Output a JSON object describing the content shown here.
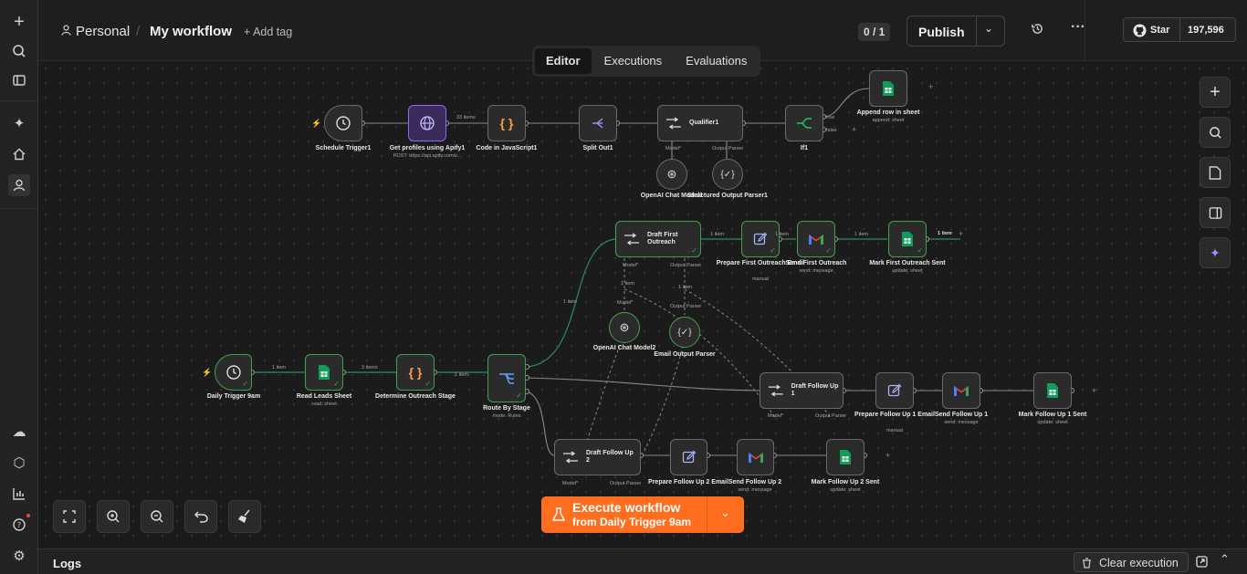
{
  "header": {
    "project": "Personal",
    "workflow_name": "My workflow",
    "add_tag": "+ Add tag",
    "counter": "0 / 1",
    "publish": "Publish",
    "github_star": "Star",
    "star_count": "197,596"
  },
  "tabs": [
    {
      "label": "Editor"
    },
    {
      "label": "Executions"
    },
    {
      "label": "Evaluations"
    }
  ],
  "nodes": {
    "schedule_trigger": {
      "label": "Schedule Trigger1"
    },
    "get_profiles": {
      "label": "Get profiles using Apify1",
      "sub": "POST: https://api.apify.com/v..."
    },
    "code_js": {
      "label": "Code in JavaScript1"
    },
    "split_out": {
      "label": "Split Out1"
    },
    "qualifier": {
      "label": "Qualifier1",
      "model": "Model*",
      "parser": "Output Parser"
    },
    "if1": {
      "label": "If1",
      "true": "true",
      "false": "false"
    },
    "append_row": {
      "label": "Append row in sheet",
      "sub": "append: sheet"
    },
    "openai1": {
      "label": "OpenAI Chat Model1"
    },
    "structured_parser": {
      "label": "Structured Output Parser1"
    },
    "daily_trigger": {
      "label": "Daily Trigger 9am"
    },
    "read_leads": {
      "label": "Read Leads Sheet",
      "sub": "read: sheet"
    },
    "determine_stage": {
      "label": "Determine Outreach Stage"
    },
    "route_stage": {
      "label": "Route By Stage",
      "sub": "mode: Rules"
    },
    "draft_first": {
      "label": "Draft First Outreach",
      "model": "Model*",
      "parser": "Output Parser"
    },
    "prepare_first": {
      "label": "Prepare First Outreach Email",
      "sub": "manual"
    },
    "send_first": {
      "label": "Send First Outreach",
      "sub": "send: message"
    },
    "mark_first": {
      "label": "Mark First Outreach Sent",
      "sub": "update: sheet"
    },
    "openai2": {
      "label": "OpenAI Chat Model2"
    },
    "email_parser": {
      "label": "Email Output Parser"
    },
    "draft_fu1": {
      "label": "Draft Follow Up 1",
      "model": "Model*",
      "parser": "Output Parser"
    },
    "prepare_fu1": {
      "label": "Prepare Follow Up 1 Email",
      "sub": "manual"
    },
    "send_fu1": {
      "label": "Send Follow Up 1",
      "sub": "send: message"
    },
    "mark_fu1": {
      "label": "Mark Follow Up 1 Sent",
      "sub": "update: sheet"
    },
    "draft_fu2": {
      "label": "Draft Follow Up 2",
      "model": "Model*",
      "parser": "Output Parser"
    },
    "prepare_fu2": {
      "label": "Prepare Follow Up 2 Email"
    },
    "send_fu2": {
      "label": "Send Follow Up 2",
      "sub": "send: message"
    },
    "mark_fu2": {
      "label": "Mark Follow Up 2 Sent",
      "sub": "update: sheet"
    }
  },
  "connections": {
    "items_33": "33 items",
    "one_item": "1 item",
    "three_items": "3 items"
  },
  "execute": {
    "title": "Execute workflow",
    "subtitle": "from Daily Trigger 9am"
  },
  "logs": {
    "title": "Logs",
    "clear": "Clear execution"
  },
  "colors": {
    "accent": "#ff6d1f",
    "success": "#3fa34d",
    "node_border": "#6b6b6b",
    "canvas": "#1b1b1b"
  }
}
